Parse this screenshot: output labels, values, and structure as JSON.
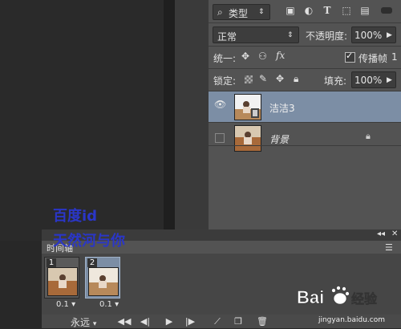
{
  "layers_panel": {
    "kind_label": "类型",
    "blend_mode": "正常",
    "opacity_label": "不透明度:",
    "opacity_value": "100%",
    "unify_label": "统一:",
    "propagate_label": "传播帧",
    "propagate_value": "1",
    "propagate_checked": true,
    "lock_label": "锁定:",
    "fill_label": "填充:",
    "fill_value": "100%",
    "layers": [
      {
        "name": "洁洁3",
        "visible": true,
        "selected": true,
        "locked": false
      },
      {
        "name": "背景",
        "visible": false,
        "selected": false,
        "locked": true
      }
    ]
  },
  "timeline": {
    "tab_label": "时间轴",
    "frames": [
      {
        "number": "1",
        "delay": "0.1",
        "selected": false
      },
      {
        "number": "2",
        "delay": "0.1",
        "selected": true
      }
    ],
    "loop_option": "永远"
  },
  "watermark": {
    "line1": "百度id",
    "line2": "天然河与你",
    "baidu_text": "Bai 经验",
    "baidu_url": "jingyan.baidu.com"
  },
  "colors": {
    "panel_bg": "#535353",
    "selected_bg": "#7c8ea5",
    "watermark": "#2a36c8"
  },
  "icons": {
    "filter": [
      "image-filter-icon",
      "adjustment-filter-icon",
      "type-filter-icon",
      "shape-filter-icon",
      "smart-object-filter-icon"
    ],
    "unify": [
      "unify-position-icon",
      "unify-visibility-icon",
      "unify-style-icon"
    ],
    "lock": [
      "lock-transparent-icon",
      "lock-brush-icon",
      "lock-move-icon",
      "lock-all-icon"
    ],
    "controls": [
      "first-frame-icon",
      "prev-frame-icon",
      "play-icon",
      "next-frame-icon",
      "tween-icon",
      "duplicate-frame-icon",
      "delete-frame-icon"
    ]
  }
}
